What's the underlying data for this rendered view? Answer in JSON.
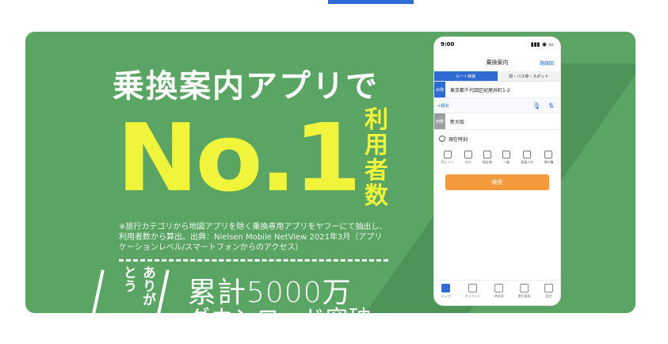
{
  "banner": {
    "headline": "乗換案内アプリで",
    "badge": "No.1",
    "users_chars": [
      "利",
      "用",
      "者",
      "数"
    ],
    "note": "※旅行カテゴリから地図アプリを除く乗換専用アプリをヤフーにて抽出し、利用者数から算出。出典：Nielsen Mobile NetView 2021年3月（アプリケーションレベル/スマートフォンからのアクセス）",
    "thanks": "ありがとう",
    "count": "累計5000万",
    "download": "ダウンロード突破"
  },
  "phone": {
    "time": "9:00",
    "signal": "▮▮▮ ◉ ▭",
    "title": "乗換案内",
    "right_link": "路線図",
    "tabs": [
      "ルート検索",
      "駅・バス停・スポット"
    ],
    "from_label": "出発",
    "from_value": "東京都千代田区紀尾井町1-2",
    "via_label": "+経由",
    "to_label": "到着",
    "to_value": "新大阪",
    "time_label": "現在時刻",
    "modes": [
      "ICレート",
      "ゼロ",
      "指定席",
      "一般",
      "高速バス",
      "飛行機"
    ],
    "search_label": "検索",
    "bottom_nav": [
      "トップ",
      "マイページ",
      "時刻表",
      "運行情報",
      "設定"
    ]
  },
  "colors": {
    "banner_green": "#5aa464",
    "accent_yellow": "#f0f53c",
    "tab_blue": "#2f6bd2",
    "search_orange": "#f39a3c"
  }
}
